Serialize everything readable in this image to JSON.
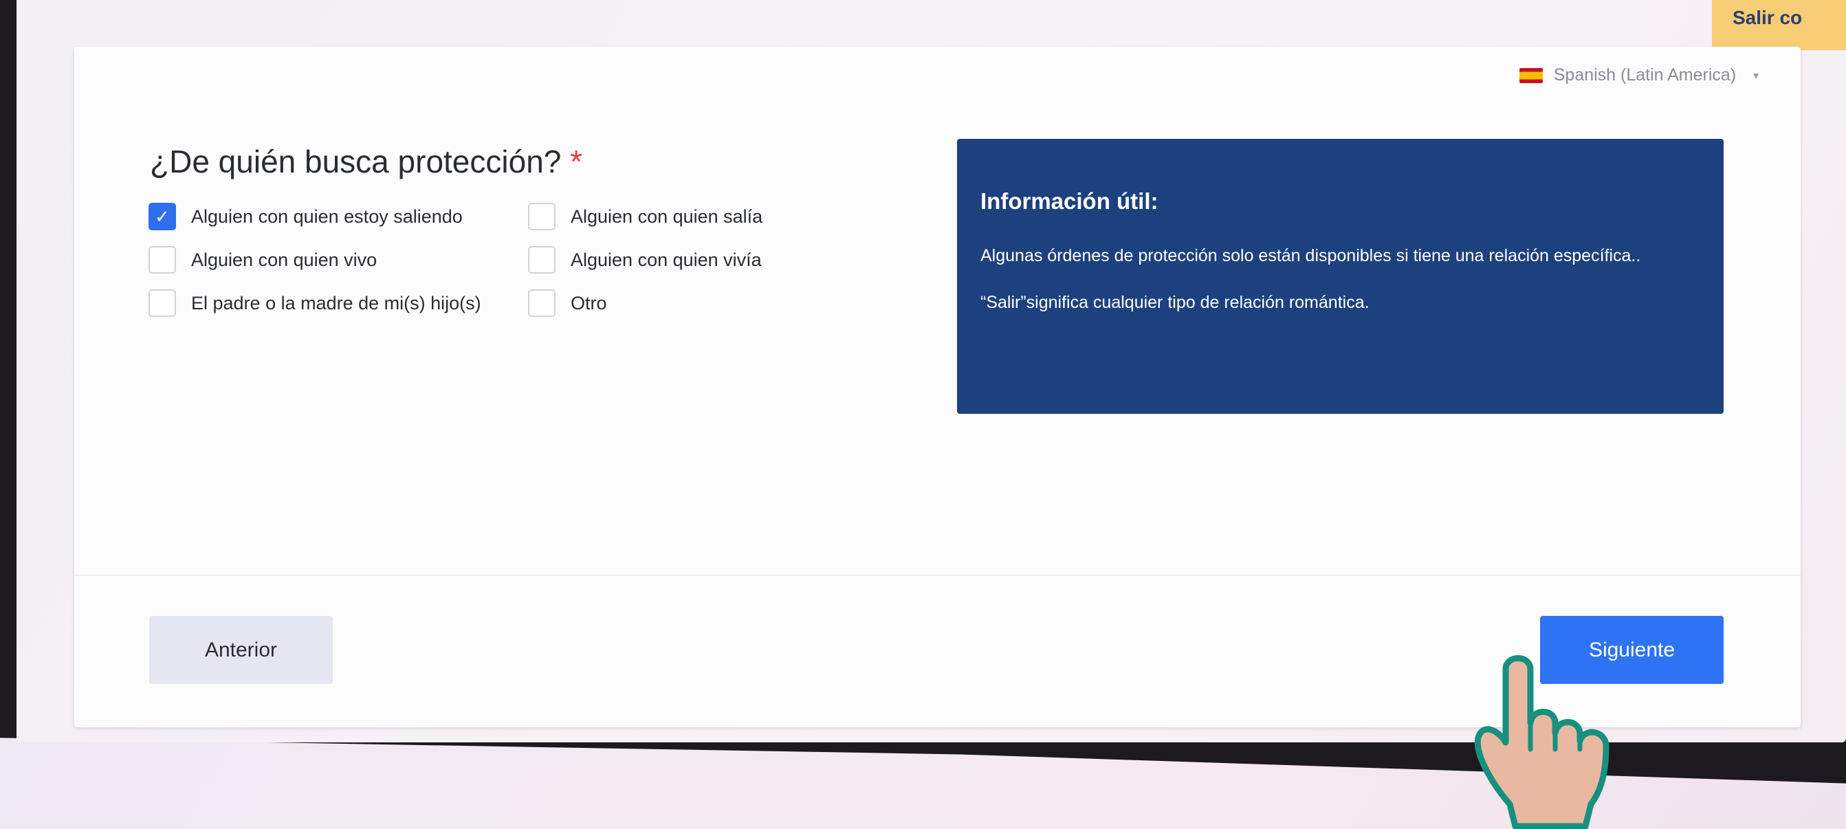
{
  "header": {
    "exit_button_label": "Salir co",
    "language": "Spanish (Latin America)",
    "language_icon": "spain-flag-icon"
  },
  "question": {
    "text": "¿De quién busca protección?",
    "required_mark": "*"
  },
  "options": [
    {
      "label": "Alguien con quien estoy saliendo",
      "checked": true
    },
    {
      "label": "Alguien con quien salía",
      "checked": false
    },
    {
      "label": "Alguien con quien vivo",
      "checked": false
    },
    {
      "label": "Alguien con quien vivía",
      "checked": false
    },
    {
      "label": "El padre o la madre de mi(s) hijo(s)",
      "checked": false
    },
    {
      "label": "Otro",
      "checked": false
    }
  ],
  "info": {
    "title": "Información útil:",
    "text1": "Algunas órdenes de protección solo están disponibles si tiene una relación específica..",
    "text2": "“Salir”significa cualquier tipo de relación romántica."
  },
  "footer": {
    "prev_label": "Anterior",
    "next_label": "Siguiente"
  },
  "colors": {
    "accent_blue": "#2f73f5",
    "info_bg": "#1c417e",
    "exit_bg": "#f6cc74",
    "hand_fill": "#e8b9a0",
    "hand_stroke": "#17907f"
  }
}
